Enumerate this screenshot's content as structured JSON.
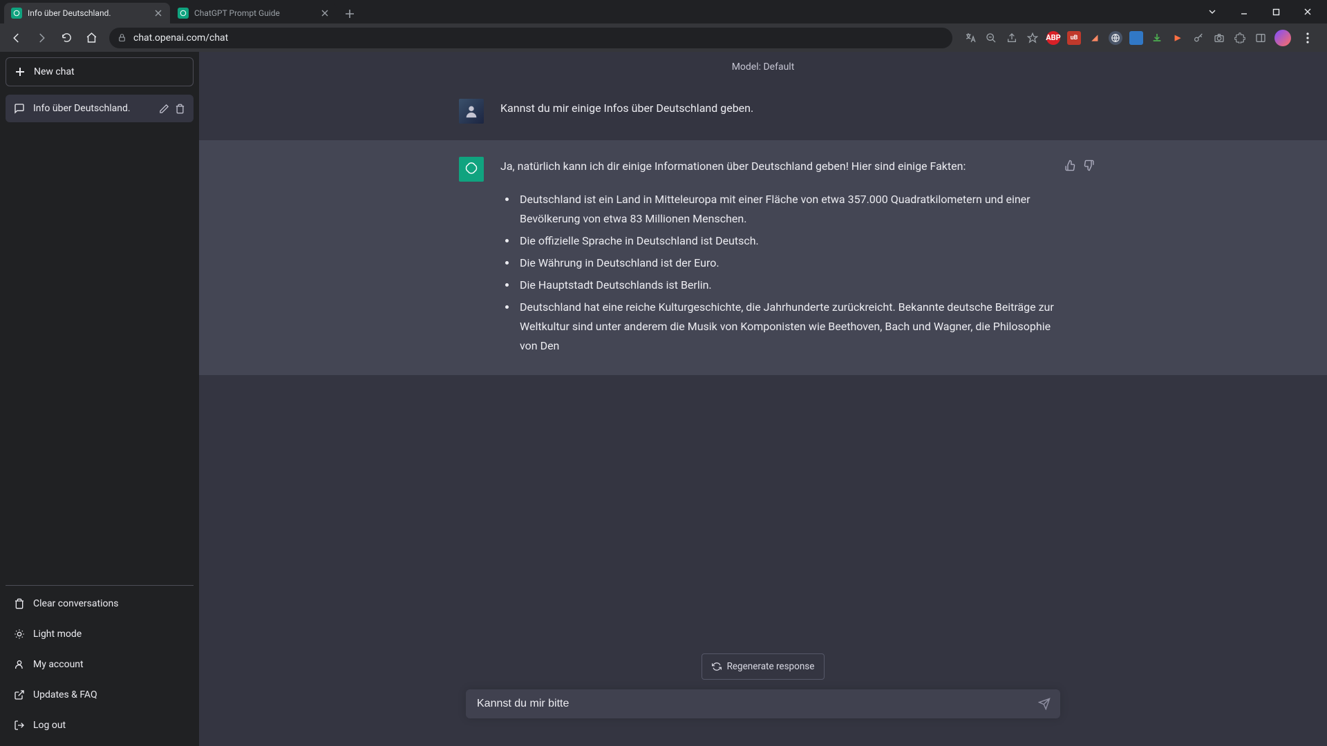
{
  "browser": {
    "tabs": [
      {
        "title": "Info über Deutschland.",
        "active": true
      },
      {
        "title": "ChatGPT Prompt Guide",
        "active": false
      }
    ],
    "url": "chat.openai.com/chat"
  },
  "sidebar": {
    "new_chat": "New chat",
    "conversations": [
      {
        "title": "Info über Deutschland."
      }
    ],
    "links": {
      "clear": "Clear conversations",
      "theme": "Light mode",
      "account": "My account",
      "updates": "Updates & FAQ",
      "logout": "Log out"
    }
  },
  "main": {
    "model_label": "Model: Default",
    "user_msg": "Kannst du mir einige Infos über Deutschland geben.",
    "bot_intro": "Ja, natürlich kann ich dir einige Informationen über Deutschland geben! Hier sind einige Fakten:",
    "bot_bullets": [
      "Deutschland ist ein Land in Mitteleuropa mit einer Fläche von etwa 357.000 Quadratkilometern und einer Bevölkerung von etwa 83 Millionen Menschen.",
      "Die offizielle Sprache in Deutschland ist Deutsch.",
      "Die Währung in Deutschland ist der Euro.",
      "Die Hauptstadt Deutschlands ist Berlin.",
      "Deutschland hat eine reiche Kulturgeschichte, die Jahrhunderte zurückreicht. Bekannte deutsche Beiträge zur Weltkultur sind unter anderem die Musik von Komponisten wie Beethoven, Bach und Wagner, die Philosophie von Den"
    ],
    "regenerate": "Regenerate response",
    "input_value": "Kannst du mir bitte"
  }
}
